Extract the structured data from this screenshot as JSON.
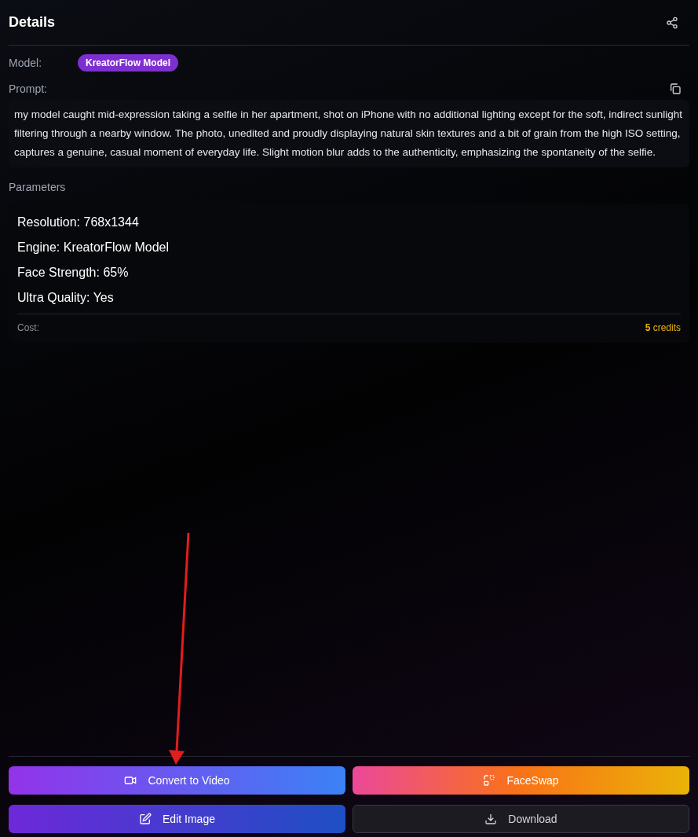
{
  "header": {
    "title": "Details"
  },
  "model": {
    "label": "Model:",
    "badge": "KreatorFlow Model"
  },
  "prompt": {
    "label": "Prompt:",
    "text": "my model caught mid-expression taking a selfie in her apartment, shot on iPhone with no additional lighting except for the soft, indirect sunlight filtering through a nearby window. The photo, unedited and proudly displaying natural skin textures and a bit of grain from the high ISO setting, captures a genuine, casual moment of everyday life. Slight motion blur adds to the authenticity, emphasizing the spontaneity of the selfie."
  },
  "parameters": {
    "label": "Parameters",
    "items": [
      "Resolution: 768x1344",
      "Engine: KreatorFlow Model",
      "Face Strength: 65%",
      "Ultra Quality: Yes"
    ],
    "cost_label": "Cost:",
    "cost_amount": "5",
    "cost_unit": "credits"
  },
  "buttons": [
    {
      "label": "Convert to Video",
      "kind": "video"
    },
    {
      "label": "FaceSwap",
      "kind": "faceswap"
    },
    {
      "label": "Edit Image",
      "kind": "edit"
    },
    {
      "label": "Download",
      "kind": "download"
    }
  ]
}
